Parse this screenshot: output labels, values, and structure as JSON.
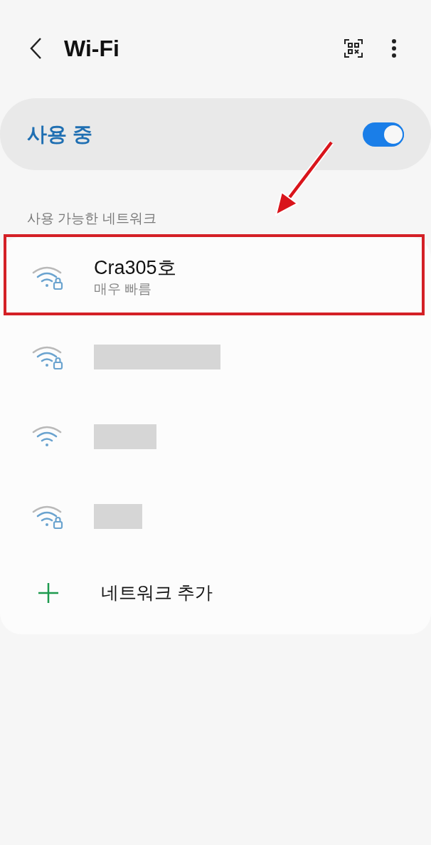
{
  "header": {
    "title": "Wi-Fi"
  },
  "master_switch": {
    "label": "사용 중",
    "on": true
  },
  "section_label": "사용 가능한 네트워크",
  "networks": [
    {
      "kind": "named",
      "name": "Cra305호",
      "status": "매우 빠름",
      "secured": true,
      "highlighted": true
    },
    {
      "kind": "redacted",
      "secured": true,
      "highlighted": false
    },
    {
      "kind": "redacted",
      "secured": false,
      "highlighted": false
    },
    {
      "kind": "redacted",
      "secured": true,
      "highlighted": false
    }
  ],
  "add_network": {
    "label": "네트워크 추가"
  }
}
